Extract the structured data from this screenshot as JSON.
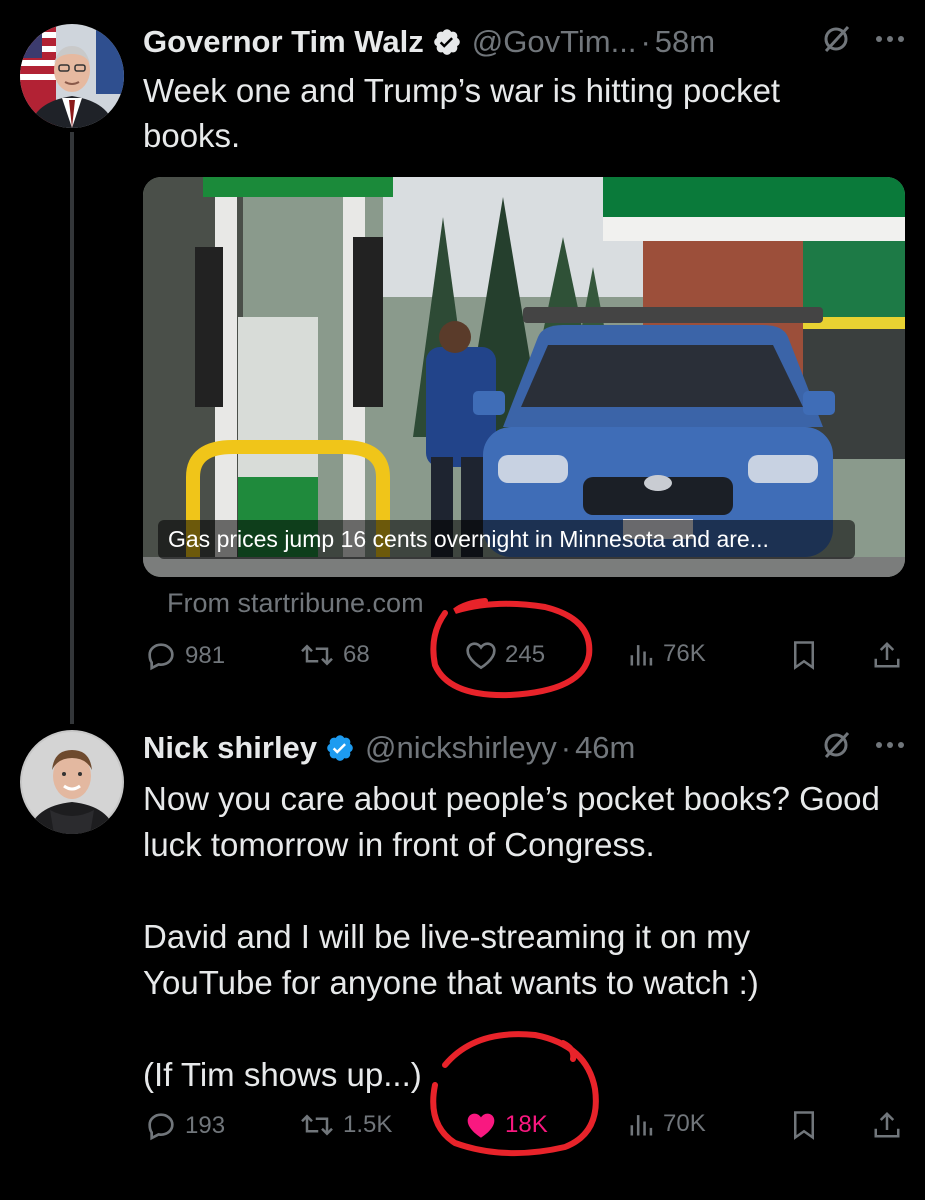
{
  "tweets": [
    {
      "name": "Governor Tim Walz",
      "handle": "@GovTim...",
      "separator": "·",
      "time": "58m",
      "text": "Week one and Trump’s war is hitting pocket books.",
      "card": {
        "caption": "Gas prices jump 16 cents overnight in Minnesota and are...",
        "source": "From startribune.com"
      },
      "stats": {
        "replies": "981",
        "reposts": "68",
        "likes": "245",
        "views": "76K"
      },
      "liked": false
    },
    {
      "name": "Nick shirley",
      "handle": "@nickshirleyy",
      "separator": "·",
      "time": "46m",
      "text": "Now you care about people’s pocket books? Good luck tomorrow in front of Congress.\n\nDavid and I will be live-streaming it on my YouTube for anyone that wants to watch :)\n\n(If Tim shows up...)",
      "stats": {
        "replies": "193",
        "reposts": "1.5K",
        "likes": "18K",
        "views": "70K"
      },
      "liked": true
    }
  ],
  "colors": {
    "background": "#000000",
    "text": "#e7e9ea",
    "secondary": "#71767b",
    "verified": "#1d9bf0",
    "like_active": "#f91880",
    "annotation": "#e8232a"
  },
  "icons": [
    "verified-badge-icon",
    "grok-icon",
    "more-icon",
    "reply-icon",
    "repost-icon",
    "like-icon",
    "views-icon",
    "bookmark-icon",
    "share-icon"
  ]
}
